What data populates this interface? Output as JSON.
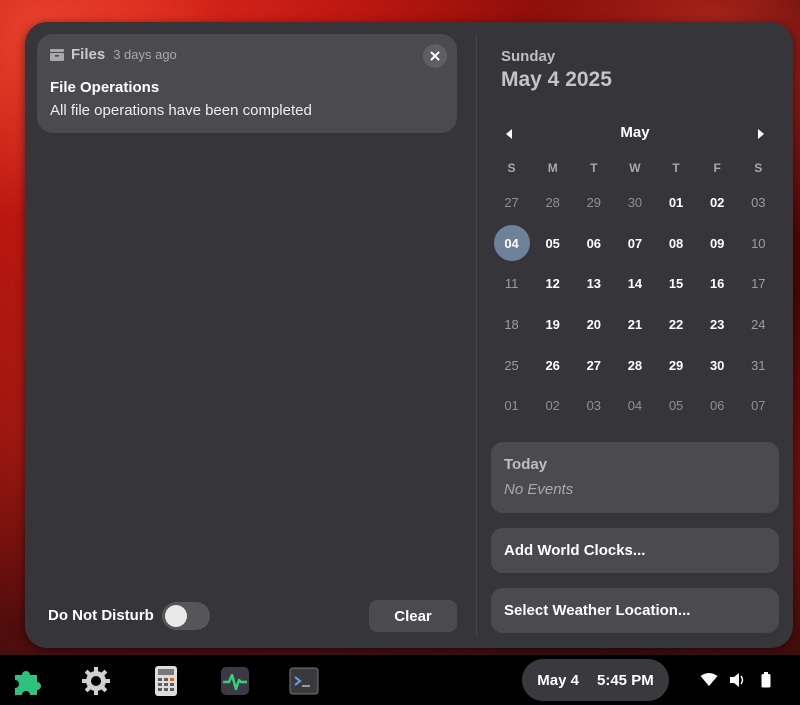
{
  "notification": {
    "app": "Files",
    "time": "3 days ago",
    "title": "File Operations",
    "body": "All file operations have been completed"
  },
  "dnd": {
    "label": "Do Not Disturb",
    "enabled": false
  },
  "clear_label": "Clear",
  "calendar": {
    "day_name": "Sunday",
    "date": "May 4 2025",
    "month": "May",
    "weekdays": [
      "S",
      "M",
      "T",
      "W",
      "T",
      "F",
      "S"
    ],
    "weeks": [
      [
        "27",
        "28",
        "29",
        "30",
        "01",
        "02",
        "03"
      ],
      [
        "04",
        "05",
        "06",
        "07",
        "08",
        "09",
        "10"
      ],
      [
        "11",
        "12",
        "13",
        "14",
        "15",
        "16",
        "17"
      ],
      [
        "18",
        "19",
        "20",
        "21",
        "22",
        "23",
        "24"
      ],
      [
        "25",
        "26",
        "27",
        "28",
        "29",
        "30",
        "31"
      ],
      [
        "01",
        "02",
        "03",
        "04",
        "05",
        "06",
        "07"
      ]
    ],
    "today": "04"
  },
  "events": {
    "title": "Today",
    "body": "No Events"
  },
  "world_clocks_label": "Add World Clocks...",
  "weather_label": "Select Weather Location...",
  "taskbar": {
    "apps": [
      "extensions-icon",
      "settings-icon",
      "calculator-icon",
      "system-monitor-icon",
      "terminal-icon"
    ],
    "date": "May 4",
    "time": "5:45 PM"
  }
}
